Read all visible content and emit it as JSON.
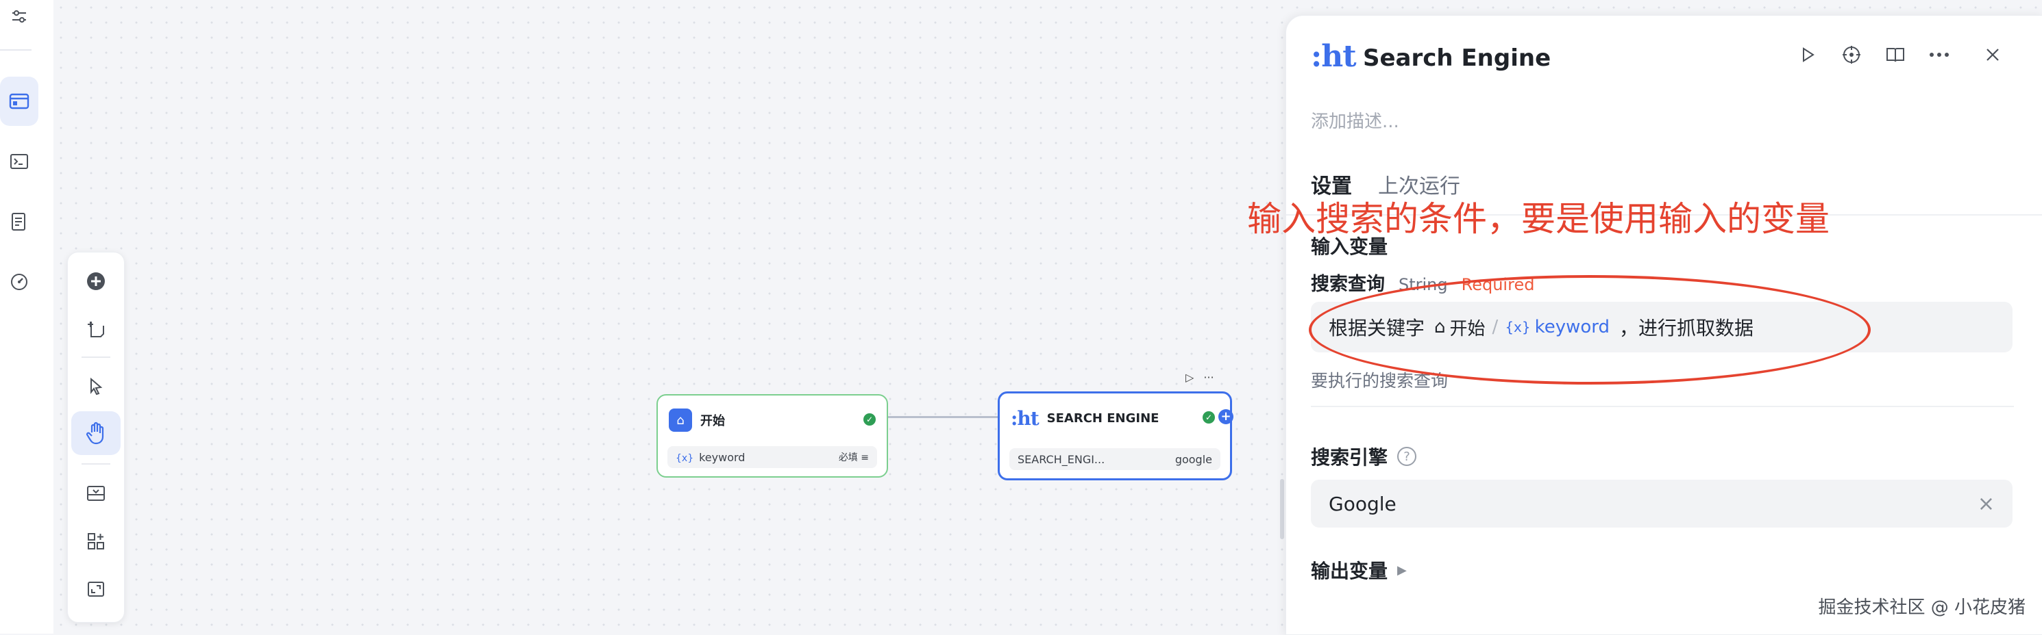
{
  "nav": {
    "items": [
      "settings-sliders",
      "workflow",
      "terminal",
      "logs",
      "monitor"
    ],
    "active": "workflow"
  },
  "palette": {
    "tools": [
      "add-node",
      "add-note",
      "pointer",
      "hand",
      "import",
      "layout",
      "fit-view"
    ],
    "active": "hand"
  },
  "nodes": {
    "start": {
      "title": "开始",
      "var_prefix": "{x}",
      "var_name": "keyword",
      "required_label": "必填"
    },
    "search": {
      "logo": ":ht",
      "title": "SEARCH ENGINE",
      "param": "SEARCH_ENGI...",
      "value": "google"
    }
  },
  "panel": {
    "logo": ":ht",
    "title": "Search Engine",
    "description_placeholder": "添加描述...",
    "tabs": [
      "设置",
      "上次运行"
    ],
    "active_tab": "设置",
    "inputs_title": "输入变量",
    "query_field": {
      "label": "搜索查询",
      "type": "String",
      "required": "Required",
      "prefix_text": "根据关键字",
      "chip_node": "开始",
      "chip_sep": "/",
      "chip_var_prefix": "{x}",
      "chip_var": "keyword",
      "suffix_text": "，进行抓取数据",
      "hint": "要执行的搜索查询"
    },
    "engine_field": {
      "label": "搜索引擎",
      "value": "Google"
    },
    "outputs_title": "输出变量"
  },
  "annotation": {
    "text": "输入搜索的条件，要是使用输入的变量",
    "color": "#e5432f"
  },
  "watermark": "掘金技术社区 @ 小花皮猪",
  "colors": {
    "accent": "#3d6fea",
    "success": "#2f9e55",
    "annotation": "#e5432f"
  }
}
